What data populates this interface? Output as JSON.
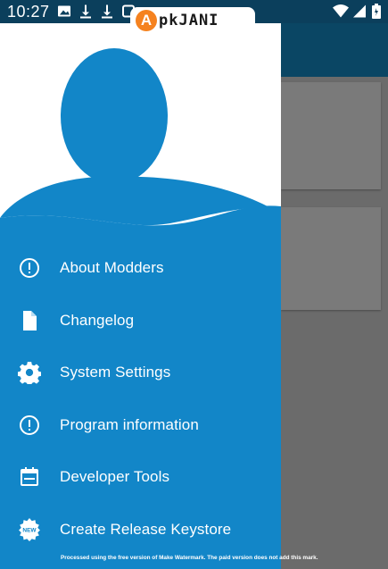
{
  "status_bar": {
    "time": "10:27",
    "left_icons": [
      "image-icon",
      "download-icon",
      "download-icon",
      "notification-icon"
    ],
    "right_icons": [
      "wifi-icon",
      "signal-icon",
      "battery-icon"
    ]
  },
  "watermark": {
    "logo_letter": "A",
    "logo_text": "pkJANI",
    "footer": "Processed using the free version of Make Watermark. The paid version does not add this mark."
  },
  "drawer": {
    "header_icon": "avatar-silhouette",
    "items": [
      {
        "label": "About Modders",
        "icon": "info-circle-icon"
      },
      {
        "label": "Changelog",
        "icon": "document-icon"
      },
      {
        "label": "System Settings",
        "icon": "gear-icon"
      },
      {
        "label": "Program information",
        "icon": "info-circle-icon"
      },
      {
        "label": "Developer Tools",
        "icon": "calendar-icon"
      },
      {
        "label": "Create Release Keystore",
        "icon": "new-badge-icon"
      }
    ]
  },
  "colors": {
    "drawer_bg": "#1286c8",
    "toolbar_bg": "#0a4664",
    "scrim_bg": "#6b6b6b",
    "logo_accent": "#f5821f"
  }
}
